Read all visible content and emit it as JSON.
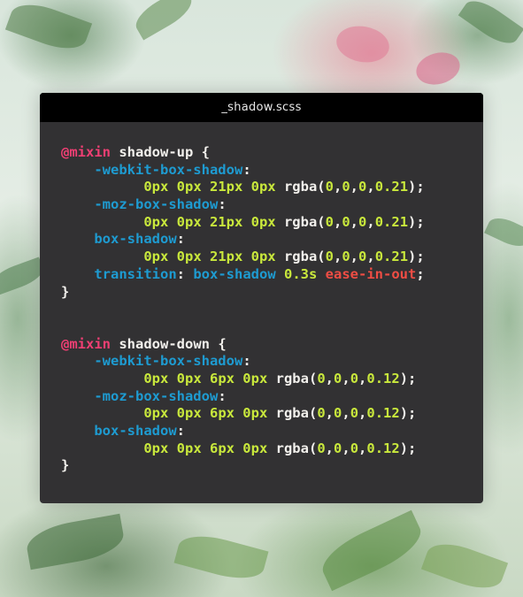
{
  "window": {
    "title": "_shadow.scss"
  },
  "code": {
    "lines": [
      [
        {
          "t": "@mixin",
          "c": "kw"
        },
        {
          "t": " shadow-up {",
          "c": "plain"
        }
      ],
      [
        {
          "t": "    ",
          "c": "plain"
        },
        {
          "t": "-webkit-box-shadow",
          "c": "prop"
        },
        {
          "t": ":",
          "c": "plain"
        }
      ],
      [
        {
          "t": "          ",
          "c": "plain"
        },
        {
          "t": "0px 0px 21px 0px",
          "c": "num"
        },
        {
          "t": " rgba(",
          "c": "plain"
        },
        {
          "t": "0",
          "c": "num"
        },
        {
          "t": ",",
          "c": "plain"
        },
        {
          "t": "0",
          "c": "num"
        },
        {
          "t": ",",
          "c": "plain"
        },
        {
          "t": "0",
          "c": "num"
        },
        {
          "t": ",",
          "c": "plain"
        },
        {
          "t": "0.21",
          "c": "num"
        },
        {
          "t": ");",
          "c": "plain"
        }
      ],
      [
        {
          "t": "    ",
          "c": "plain"
        },
        {
          "t": "-moz-box-shadow",
          "c": "prop"
        },
        {
          "t": ":",
          "c": "plain"
        }
      ],
      [
        {
          "t": "          ",
          "c": "plain"
        },
        {
          "t": "0px 0px 21px 0px",
          "c": "num"
        },
        {
          "t": " rgba(",
          "c": "plain"
        },
        {
          "t": "0",
          "c": "num"
        },
        {
          "t": ",",
          "c": "plain"
        },
        {
          "t": "0",
          "c": "num"
        },
        {
          "t": ",",
          "c": "plain"
        },
        {
          "t": "0",
          "c": "num"
        },
        {
          "t": ",",
          "c": "plain"
        },
        {
          "t": "0.21",
          "c": "num"
        },
        {
          "t": ");",
          "c": "plain"
        }
      ],
      [
        {
          "t": "    ",
          "c": "plain"
        },
        {
          "t": "box-shadow",
          "c": "prop"
        },
        {
          "t": ":",
          "c": "plain"
        }
      ],
      [
        {
          "t": "          ",
          "c": "plain"
        },
        {
          "t": "0px 0px 21px 0px",
          "c": "num"
        },
        {
          "t": " rgba(",
          "c": "plain"
        },
        {
          "t": "0",
          "c": "num"
        },
        {
          "t": ",",
          "c": "plain"
        },
        {
          "t": "0",
          "c": "num"
        },
        {
          "t": ",",
          "c": "plain"
        },
        {
          "t": "0",
          "c": "num"
        },
        {
          "t": ",",
          "c": "plain"
        },
        {
          "t": "0.21",
          "c": "num"
        },
        {
          "t": ");",
          "c": "plain"
        }
      ],
      [
        {
          "t": "    ",
          "c": "plain"
        },
        {
          "t": "transition",
          "c": "prop"
        },
        {
          "t": ": ",
          "c": "plain"
        },
        {
          "t": "box-shadow",
          "c": "prop"
        },
        {
          "t": " ",
          "c": "plain"
        },
        {
          "t": "0.3s",
          "c": "num"
        },
        {
          "t": " ",
          "c": "plain"
        },
        {
          "t": "ease-in-out",
          "c": "ease"
        },
        {
          "t": ";",
          "c": "plain"
        }
      ],
      [
        {
          "t": "}",
          "c": "plain"
        }
      ],
      [],
      [],
      [
        {
          "t": "@mixin",
          "c": "kw"
        },
        {
          "t": " shadow-down {",
          "c": "plain"
        }
      ],
      [
        {
          "t": "    ",
          "c": "plain"
        },
        {
          "t": "-webkit-box-shadow",
          "c": "prop"
        },
        {
          "t": ":",
          "c": "plain"
        }
      ],
      [
        {
          "t": "          ",
          "c": "plain"
        },
        {
          "t": "0px 0px 6px 0px",
          "c": "num"
        },
        {
          "t": " rgba(",
          "c": "plain"
        },
        {
          "t": "0",
          "c": "num"
        },
        {
          "t": ",",
          "c": "plain"
        },
        {
          "t": "0",
          "c": "num"
        },
        {
          "t": ",",
          "c": "plain"
        },
        {
          "t": "0",
          "c": "num"
        },
        {
          "t": ",",
          "c": "plain"
        },
        {
          "t": "0.12",
          "c": "num"
        },
        {
          "t": ");",
          "c": "plain"
        }
      ],
      [
        {
          "t": "    ",
          "c": "plain"
        },
        {
          "t": "-moz-box-shadow",
          "c": "prop"
        },
        {
          "t": ":",
          "c": "plain"
        }
      ],
      [
        {
          "t": "          ",
          "c": "plain"
        },
        {
          "t": "0px 0px 6px 0px",
          "c": "num"
        },
        {
          "t": " rgba(",
          "c": "plain"
        },
        {
          "t": "0",
          "c": "num"
        },
        {
          "t": ",",
          "c": "plain"
        },
        {
          "t": "0",
          "c": "num"
        },
        {
          "t": ",",
          "c": "plain"
        },
        {
          "t": "0",
          "c": "num"
        },
        {
          "t": ",",
          "c": "plain"
        },
        {
          "t": "0.12",
          "c": "num"
        },
        {
          "t": ");",
          "c": "plain"
        }
      ],
      [
        {
          "t": "    ",
          "c": "plain"
        },
        {
          "t": "box-shadow",
          "c": "prop"
        },
        {
          "t": ":",
          "c": "plain"
        }
      ],
      [
        {
          "t": "          ",
          "c": "plain"
        },
        {
          "t": "0px 0px 6px 0px",
          "c": "num"
        },
        {
          "t": " rgba(",
          "c": "plain"
        },
        {
          "t": "0",
          "c": "num"
        },
        {
          "t": ",",
          "c": "plain"
        },
        {
          "t": "0",
          "c": "num"
        },
        {
          "t": ",",
          "c": "plain"
        },
        {
          "t": "0",
          "c": "num"
        },
        {
          "t": ",",
          "c": "plain"
        },
        {
          "t": "0.12",
          "c": "num"
        },
        {
          "t": ");",
          "c": "plain"
        }
      ],
      [
        {
          "t": "}",
          "c": "plain"
        }
      ]
    ]
  },
  "colors": {
    "window_bg": "#323133",
    "titlebar_bg": "#000000",
    "keyword": "#ef3f73",
    "property": "#1e9bd1",
    "number": "#c9e83c",
    "text": "#f2f0ec",
    "easing": "#ef4d44"
  }
}
